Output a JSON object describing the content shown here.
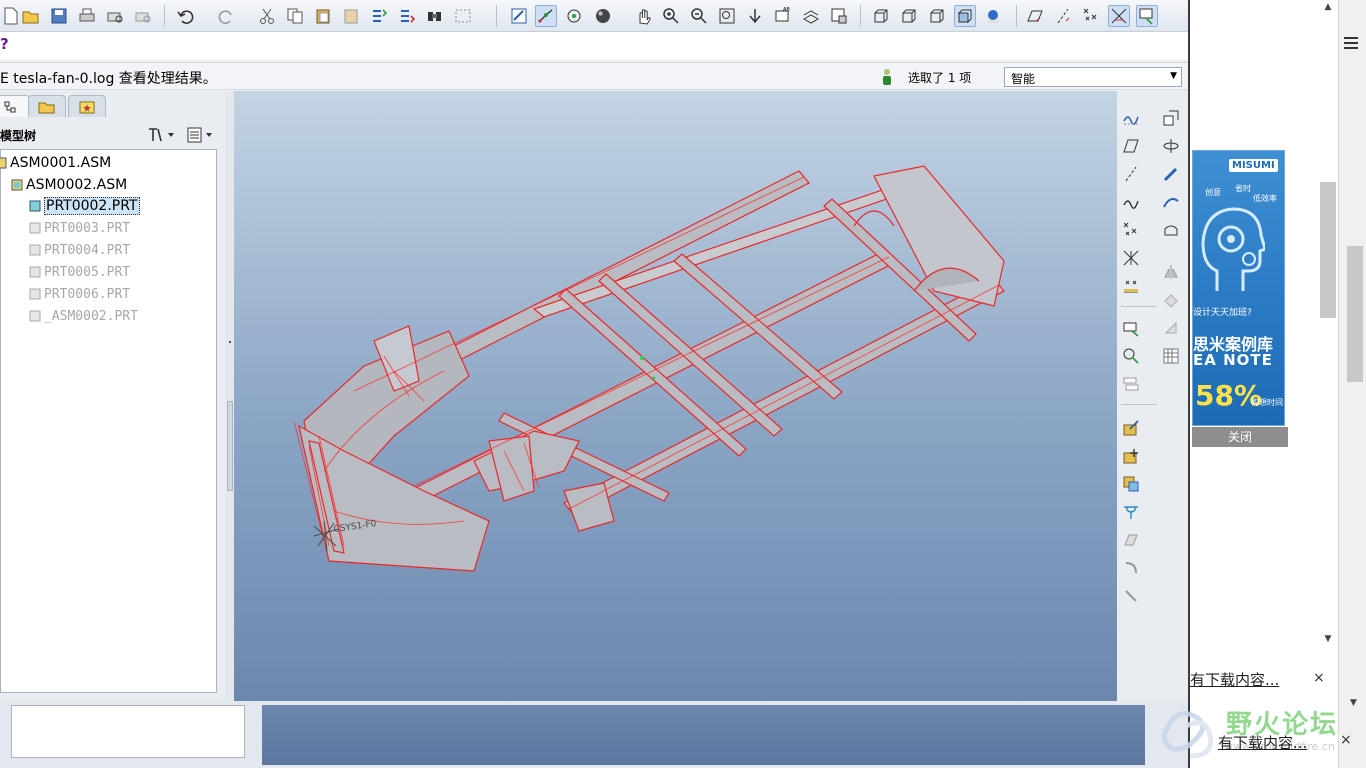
{
  "toolbar": {
    "icons": [
      "new-icon",
      "open-icon",
      "save-icon",
      "print-icon",
      "preview-icon",
      "email-icon",
      "undo-icon",
      "redo-icon",
      "cut-icon",
      "copy-icon",
      "paste-icon",
      "paste-special-icon",
      "regenerate-icon",
      "regenerate-manager-icon",
      "find-icon",
      "select-box-icon",
      "repaint-icon",
      "spin-center-icon",
      "orient-icon",
      "appearance-icon",
      "pan-icon",
      "zoom-in-icon",
      "zoom-out-icon",
      "refit-icon",
      "reorient-icon",
      "saved-views-icon",
      "layers-icon",
      "view-manager-icon",
      "wireframe-icon",
      "hidden-line-icon",
      "no-hidden-icon",
      "shading-icon",
      "enhanced-realism-icon",
      "datum-plane-icon",
      "datum-axis-icon",
      "datum-point-icon",
      "coord-sys-icon",
      "annotation-icon"
    ]
  },
  "message": {
    "question_mark": "?",
    "log_text": "E tesla-fan-0.log 查看处理结果。",
    "selection_count": "选取了 1 项",
    "filter_value": "智能"
  },
  "left_panel": {
    "tree_title": "模型树",
    "tree_items": [
      {
        "label": "ASM0001.ASM",
        "state": "normal"
      },
      {
        "label": "ASM0002.ASM",
        "state": "normal"
      },
      {
        "label": "PRT0002.PRT",
        "state": "selected"
      },
      {
        "label": "PRT0003.PRT",
        "state": "dim"
      },
      {
        "label": "PRT0004.PRT",
        "state": "dim"
      },
      {
        "label": "PRT0005.PRT",
        "state": "dim"
      },
      {
        "label": "PRT0006.PRT",
        "state": "dim"
      },
      {
        "label": "_ASM0002.PRT",
        "state": "dim"
      }
    ]
  },
  "viewport": {
    "csys_label": "CSYS1-F0",
    "model_color": "#e8282a",
    "background_top": "#c3d4e4",
    "background_bottom": "#6b87ae"
  },
  "browser": {
    "ad": {
      "brand": "MISUMI",
      "tag1": "创意",
      "tag2": "省时",
      "tag3": "低效率",
      "question": "设计天天加班?",
      "title": "思米案例库",
      "subtitle": "EA NOTE",
      "percent": "58%",
      "percent_sub": "构想时间",
      "close_label": "关闭"
    },
    "download_text_1": "有下载内容...",
    "download_text_2": "有下载内容...",
    "close_glyph": "×",
    "watermark_title": "野火论坛",
    "watermark_url": "www.proewildfire.cn"
  }
}
